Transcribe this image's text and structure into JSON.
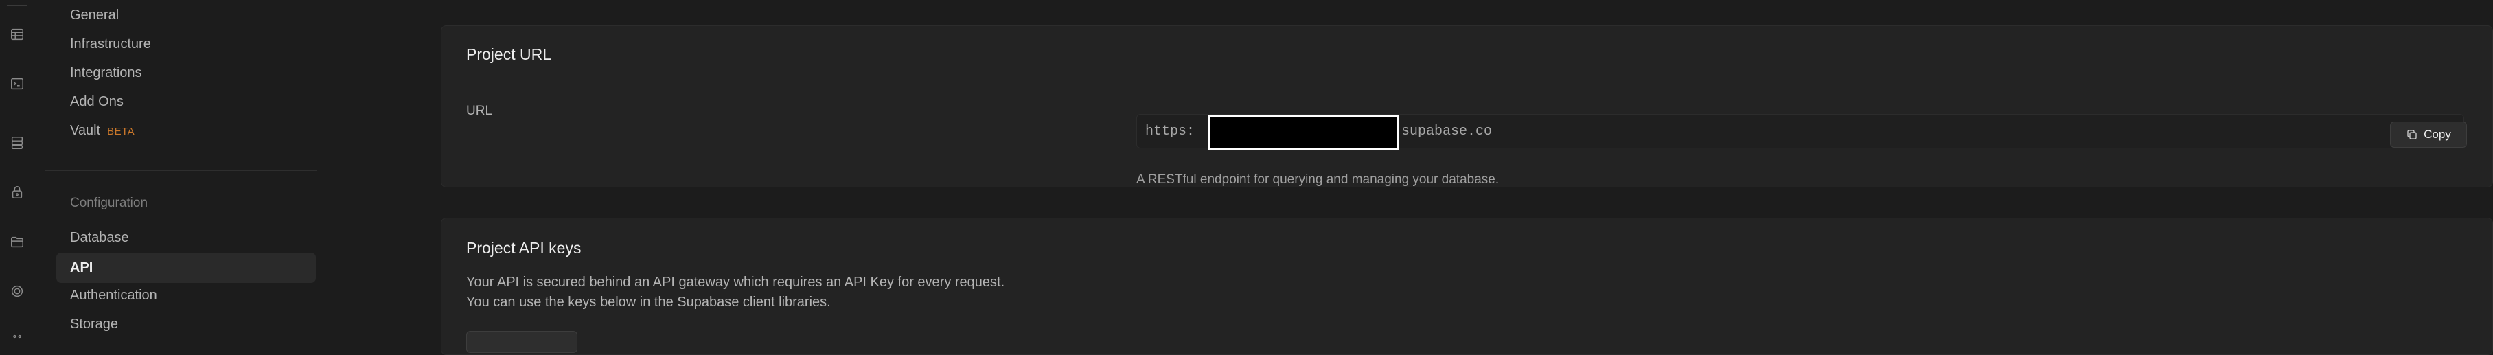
{
  "rail": {
    "icons": [
      "table-editor-icon",
      "sql-editor-icon",
      "database-icon",
      "auth-icon",
      "storage-icon",
      "realtime-icon"
    ]
  },
  "menu": {
    "items_top": [
      "General",
      "Infrastructure",
      "Integrations",
      "Add Ons",
      "Vault"
    ],
    "vault_badge": "BETA",
    "config_heading": "Configuration",
    "items_config": [
      "Database",
      "API",
      "Authentication",
      "Storage"
    ],
    "active": "API"
  },
  "project_url": {
    "title": "Project URL",
    "label": "URL",
    "url_prefix": "https:",
    "url_suffix": "supabase.co",
    "copy_label": "Copy",
    "helper": "A RESTful endpoint for querying and managing your database."
  },
  "api_keys": {
    "title": "Project API keys",
    "desc_line1": "Your API is secured behind an API gateway which requires an API Key for every request.",
    "desc_line2": "You can use the keys below in the Supabase client libraries."
  },
  "colors": {
    "background": "#1c1c1c",
    "card": "#232323",
    "beta": "#c9772a"
  }
}
